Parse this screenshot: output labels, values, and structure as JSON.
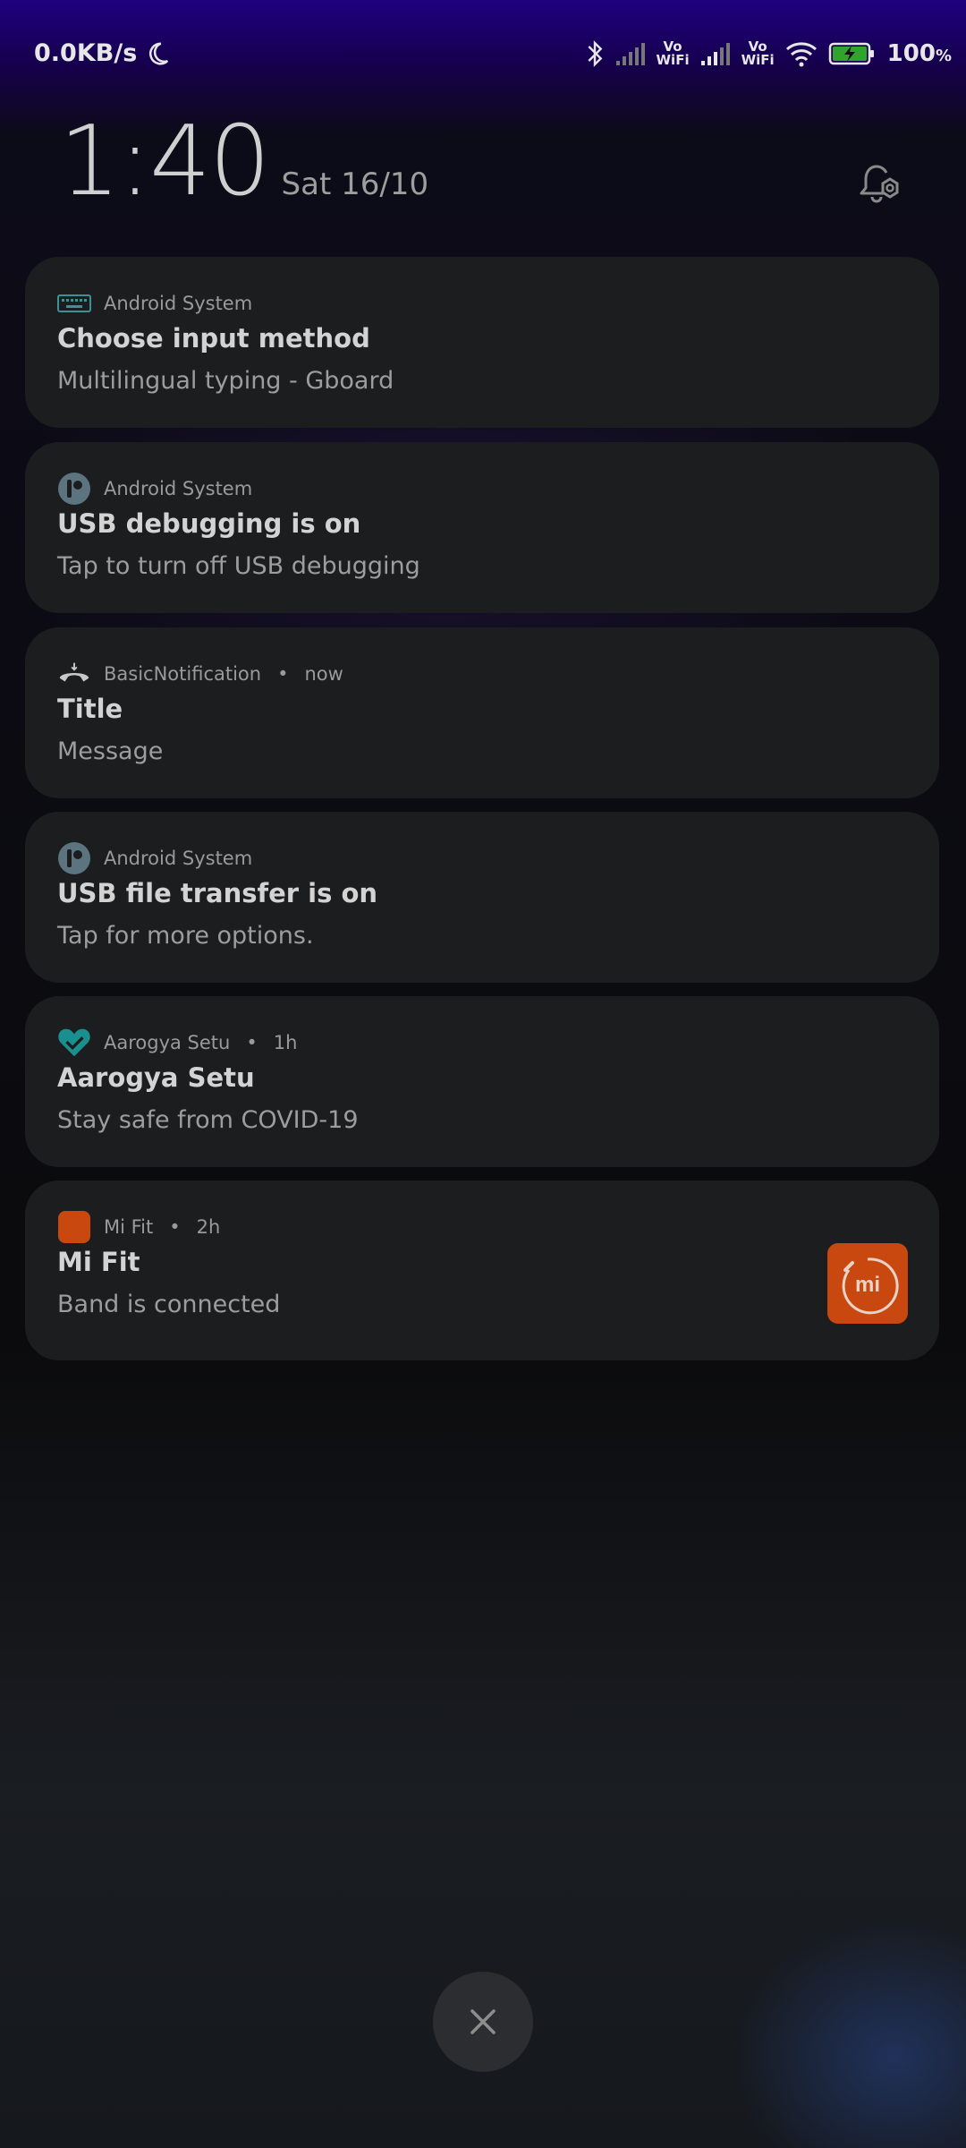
{
  "status_bar": {
    "speed": "0.0KB/s",
    "vowifi_1": "Vo\nWiFi",
    "vowifi_2": "Vo\nWiFi",
    "battery_value": "100",
    "battery_unit": "%"
  },
  "lockscreen": {
    "time": "1:40",
    "date": "Sat 16/10"
  },
  "notifications": [
    {
      "app": "Android System",
      "meta": "",
      "title": "Choose input method",
      "message": "Multilingual typing - Gboard",
      "icon": "keyboard-icon"
    },
    {
      "app": "Android System",
      "meta": "",
      "title": "USB debugging is on",
      "message": "Tap to turn off USB debugging",
      "icon": "android-system-icon"
    },
    {
      "app": "BasicNotification",
      "meta": "now",
      "title": "Title",
      "message": "Message",
      "icon": "call-end-icon"
    },
    {
      "app": "Android System",
      "meta": "",
      "title": "USB file transfer is on",
      "message": "Tap for more options.",
      "icon": "android-system-icon"
    },
    {
      "app": "Aarogya Setu",
      "meta": "1h",
      "title": "Aarogya Setu",
      "message": "Stay safe from COVID-19",
      "icon": "heart-check-icon"
    },
    {
      "app": "Mi Fit",
      "meta": "2h",
      "title": "Mi Fit",
      "message": "Band is connected",
      "icon": "mi-fit-icon",
      "logo_text": "mi"
    }
  ],
  "colors": {
    "accent_teal": "#1a8f8f",
    "mi_orange": "#c9480f",
    "card_bg": "#1c1d1f"
  }
}
